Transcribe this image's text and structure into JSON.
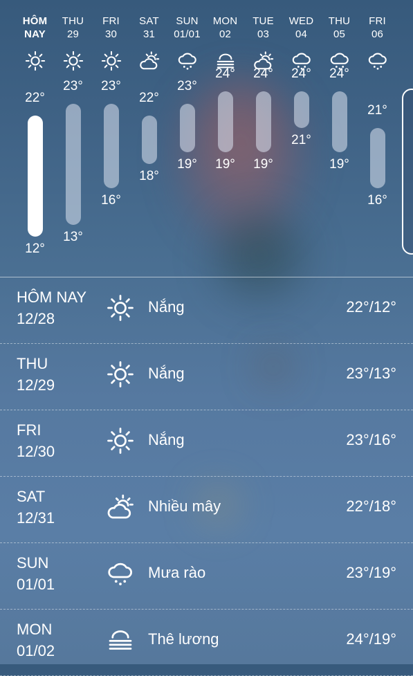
{
  "forecast": [
    {
      "name": "HÔM",
      "date": "NAY",
      "icon": "sun-icon",
      "high": 22,
      "low": 12,
      "high_label": "22°",
      "low_label": "12°",
      "today": true
    },
    {
      "name": "THU",
      "date": "29",
      "icon": "sun-icon",
      "high": 23,
      "low": 13,
      "high_label": "23°",
      "low_label": "13°"
    },
    {
      "name": "FRI",
      "date": "30",
      "icon": "sun-icon",
      "high": 23,
      "low": 16,
      "high_label": "23°",
      "low_label": "16°"
    },
    {
      "name": "SAT",
      "date": "31",
      "icon": "partly-cloudy-icon",
      "high": 22,
      "low": 18,
      "high_label": "22°",
      "low_label": "18°"
    },
    {
      "name": "SUN",
      "date": "01/01",
      "icon": "rain-shower-icon",
      "high": 23,
      "low": 19,
      "high_label": "23°",
      "low_label": "19°"
    },
    {
      "name": "MON",
      "date": "02",
      "icon": "fog-icon",
      "high": 24,
      "low": 19,
      "high_label": "24°",
      "low_label": "19°"
    },
    {
      "name": "TUE",
      "date": "03",
      "icon": "partly-cloudy-icon",
      "high": 24,
      "low": 19,
      "high_label": "24°",
      "low_label": "19°"
    },
    {
      "name": "WED",
      "date": "04",
      "icon": "rain-shower-icon",
      "high": 24,
      "low": 21,
      "high_label": "24°",
      "low_label": "21°"
    },
    {
      "name": "THU",
      "date": "05",
      "icon": "rain-shower-icon",
      "high": 24,
      "low": 19,
      "high_label": "24°",
      "low_label": "19°"
    },
    {
      "name": "FRI",
      "date": "06",
      "icon": "rain-shower-icon",
      "high": 21,
      "low": 16,
      "high_label": "21°",
      "low_label": "16°"
    }
  ],
  "daily": [
    {
      "day": "HÔM NAY",
      "date": "12/28",
      "icon": "sun-icon",
      "condition": "Nắng",
      "temps": "22°/12°"
    },
    {
      "day": "THU",
      "date": "12/29",
      "icon": "sun-icon",
      "condition": "Nắng",
      "temps": "23°/13°"
    },
    {
      "day": "FRI",
      "date": "12/30",
      "icon": "sun-icon",
      "condition": "Nắng",
      "temps": "23°/16°"
    },
    {
      "day": "SAT",
      "date": "12/31",
      "icon": "partly-cloudy-icon",
      "condition": "Nhiều mây",
      "temps": "22°/18°"
    },
    {
      "day": "SUN",
      "date": "01/01",
      "icon": "rain-shower-icon",
      "condition": "Mưa rào",
      "temps": "23°/19°"
    },
    {
      "day": "MON",
      "date": "01/02",
      "icon": "fog-icon",
      "condition": "Thê lương",
      "temps": "24°/19°"
    }
  ],
  "colors": {
    "today_bar": "#ffffff",
    "bar": "#dce4f0",
    "text": "#ffffff"
  }
}
